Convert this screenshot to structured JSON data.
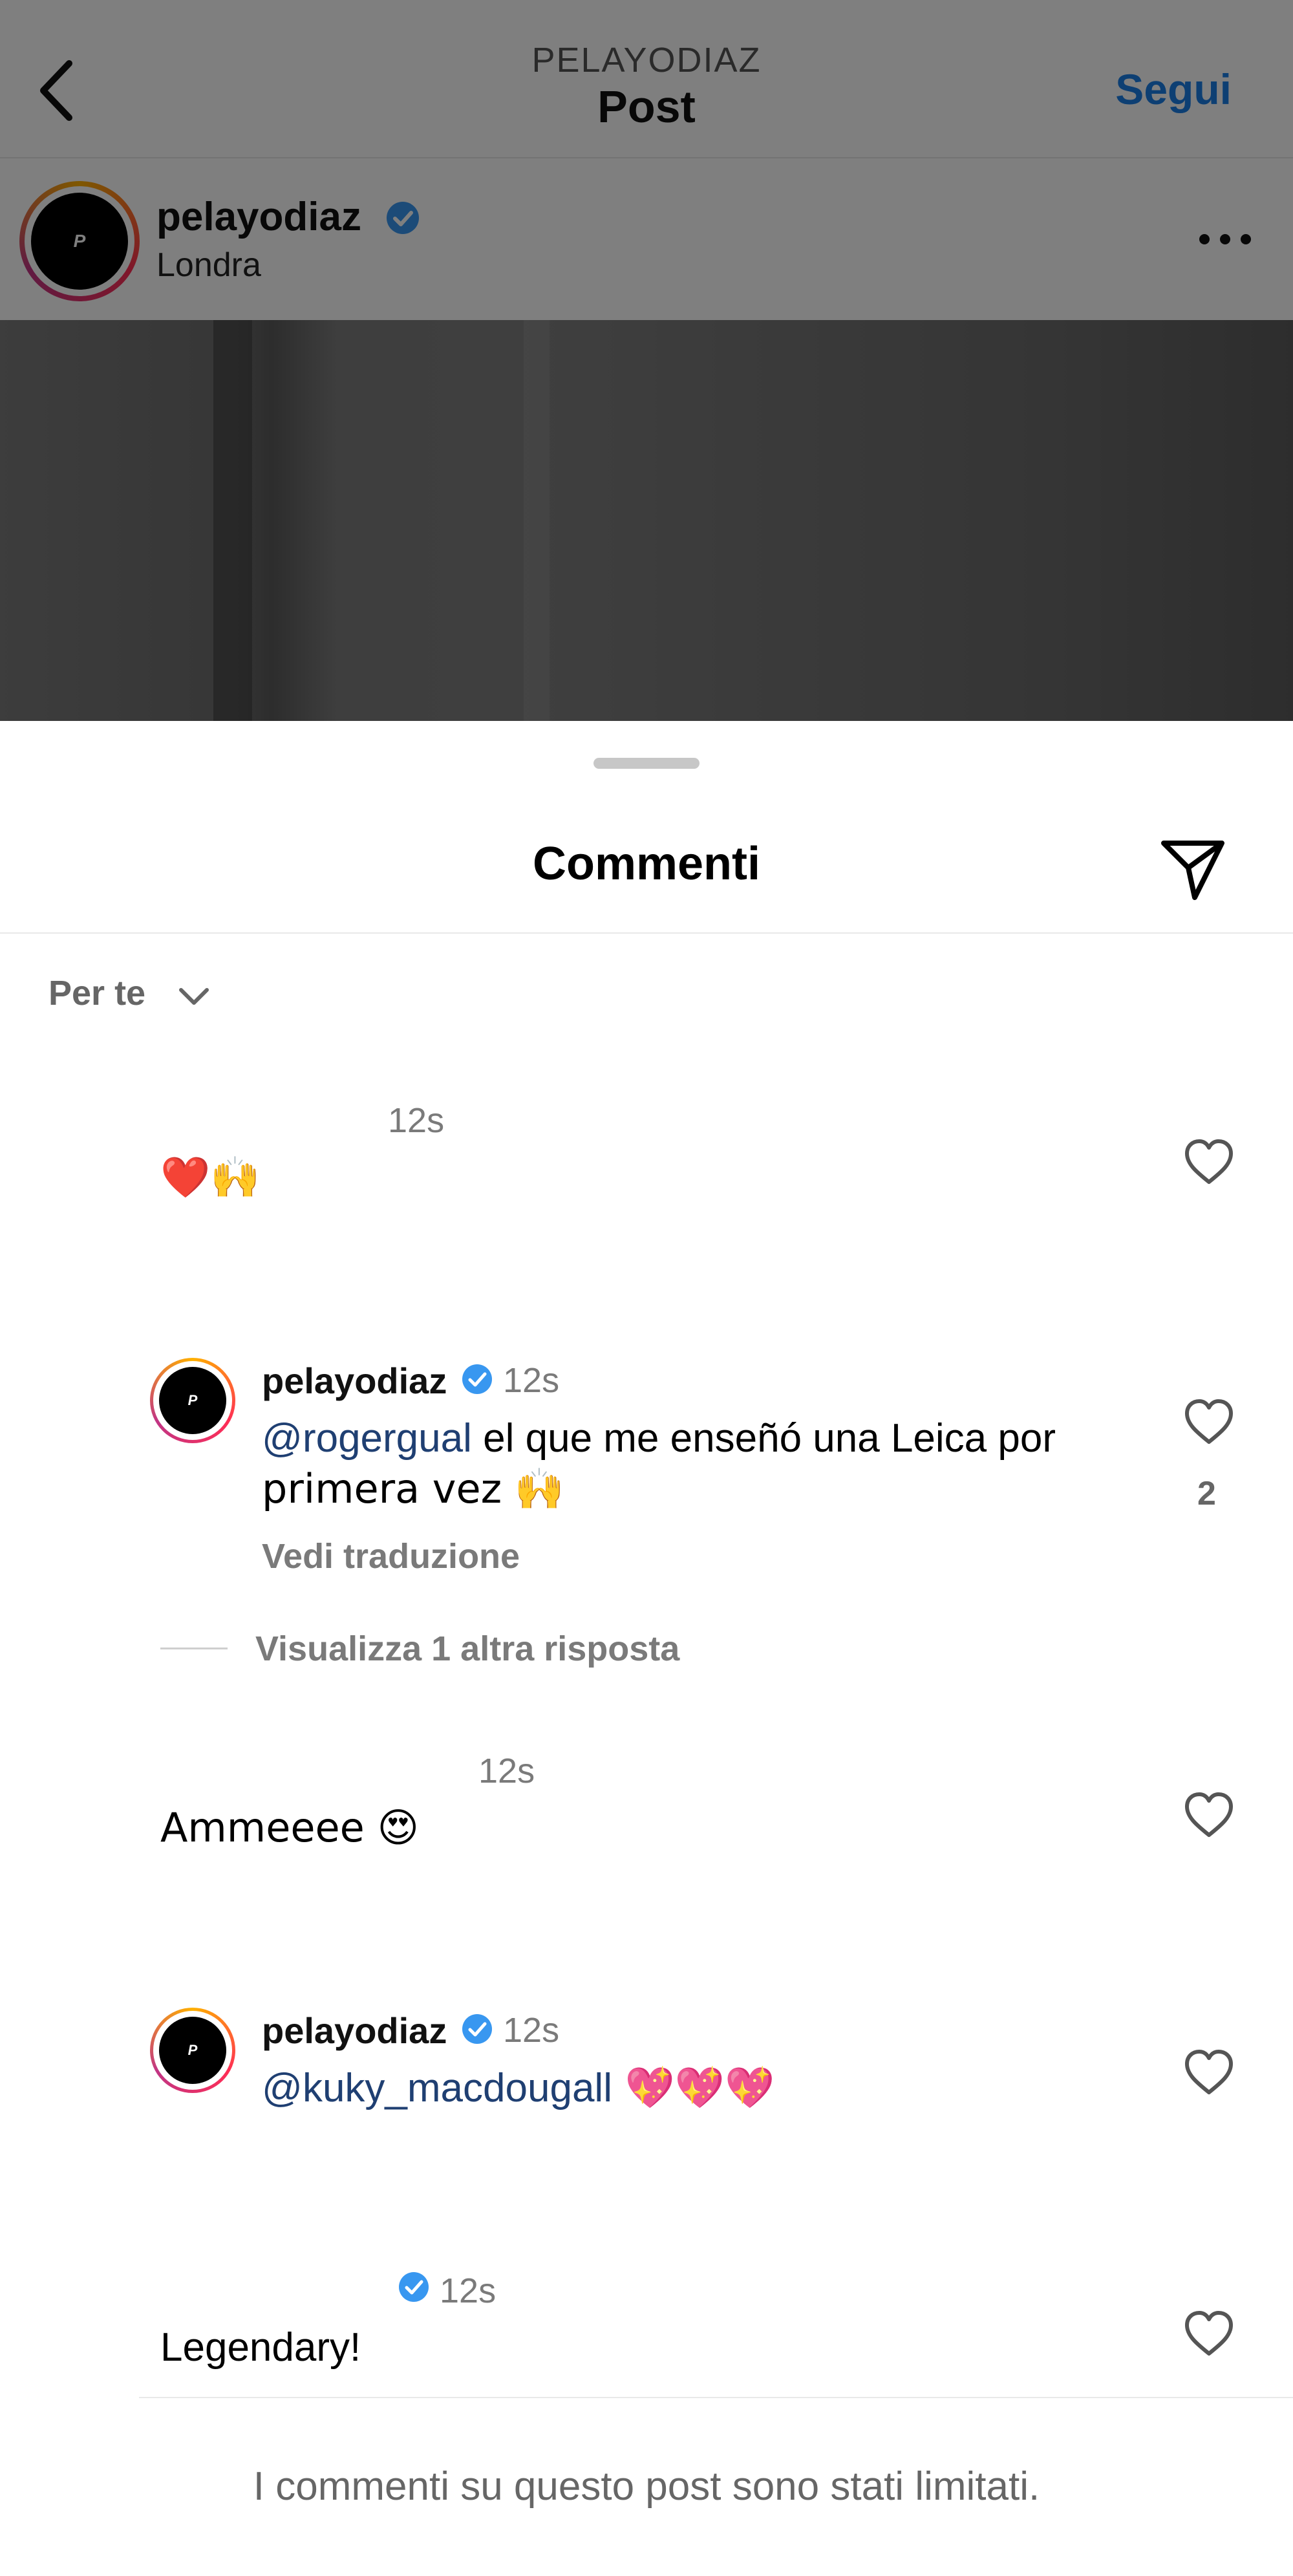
{
  "header": {
    "subtitle": "PELAYODIAZ",
    "title": "Post",
    "follow_label": "Segui"
  },
  "post": {
    "username": "pelayodiaz",
    "location": "Londra",
    "avatar_initial": "P"
  },
  "sheet": {
    "title": "Commenti",
    "sort_label": "Per te"
  },
  "comments": [
    {
      "time": "12s",
      "text": "❤️🙌"
    },
    {
      "username": "pelayodiaz",
      "time": "12s",
      "mention": "@rogergual",
      "text_line1": " el que me enseñó una Leica por",
      "text_line2": "primera vez 🙌",
      "translate_label": "Vedi traduzione",
      "likes": "2",
      "replies_label": "Visualizza 1 altra risposta",
      "avatar_initial": "P"
    },
    {
      "time": "12s",
      "text": "Ammeeee 😍"
    },
    {
      "username": "pelayodiaz",
      "time": "12s",
      "mention": "@kuky_macdougall",
      "text": " 💖💖💖",
      "avatar_initial": "P"
    },
    {
      "time": "12s",
      "text": "Legendary!"
    }
  ],
  "footer": {
    "limited_text": "I commenti su questo post sono stati limitati."
  },
  "colors": {
    "accent": "#1a7ee6",
    "mention": "#1f3f72",
    "verified": "#3897f0",
    "muted": "#7a7a7a"
  }
}
